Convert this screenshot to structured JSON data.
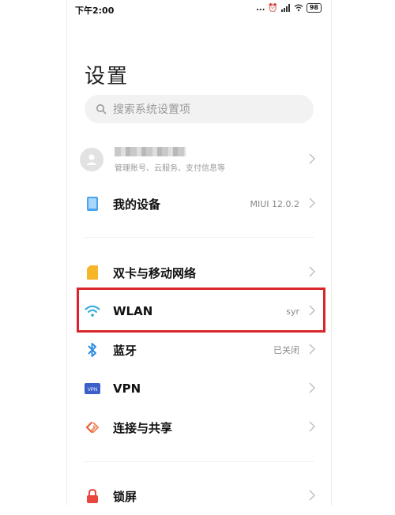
{
  "status_bar": {
    "time": "下午2:00",
    "dots": "...",
    "battery": "98"
  },
  "page_title": "设置",
  "search": {
    "placeholder": "搜索系统设置项"
  },
  "account": {
    "subtitle": "管理账号、云服务、支付信息等"
  },
  "rows": [
    {
      "label": "我的设备",
      "value": "MIUI 12.0.2",
      "icon": "device-icon",
      "color": "#4aa3ec"
    },
    {
      "label": "双卡与移动网络",
      "value": "",
      "icon": "sim-card-icon",
      "color": "#f7b529"
    },
    {
      "label": "WLAN",
      "value": "syr",
      "icon": "wifi-icon",
      "color": "#2aa7d6"
    },
    {
      "label": "蓝牙",
      "value": "已关闭",
      "icon": "bluetooth-icon",
      "color": "#2f8ee0"
    },
    {
      "label": "VPN",
      "value": "",
      "icon": "vpn-icon",
      "color": "#3c5fc9"
    },
    {
      "label": "连接与共享",
      "value": "",
      "icon": "share-icon",
      "color": "#e8603c"
    },
    {
      "label": "锁屏",
      "value": "",
      "icon": "lock-icon",
      "color": "#e9463c"
    }
  ],
  "vpn_badge_text": "VPN",
  "highlight_color": "#d9252c"
}
